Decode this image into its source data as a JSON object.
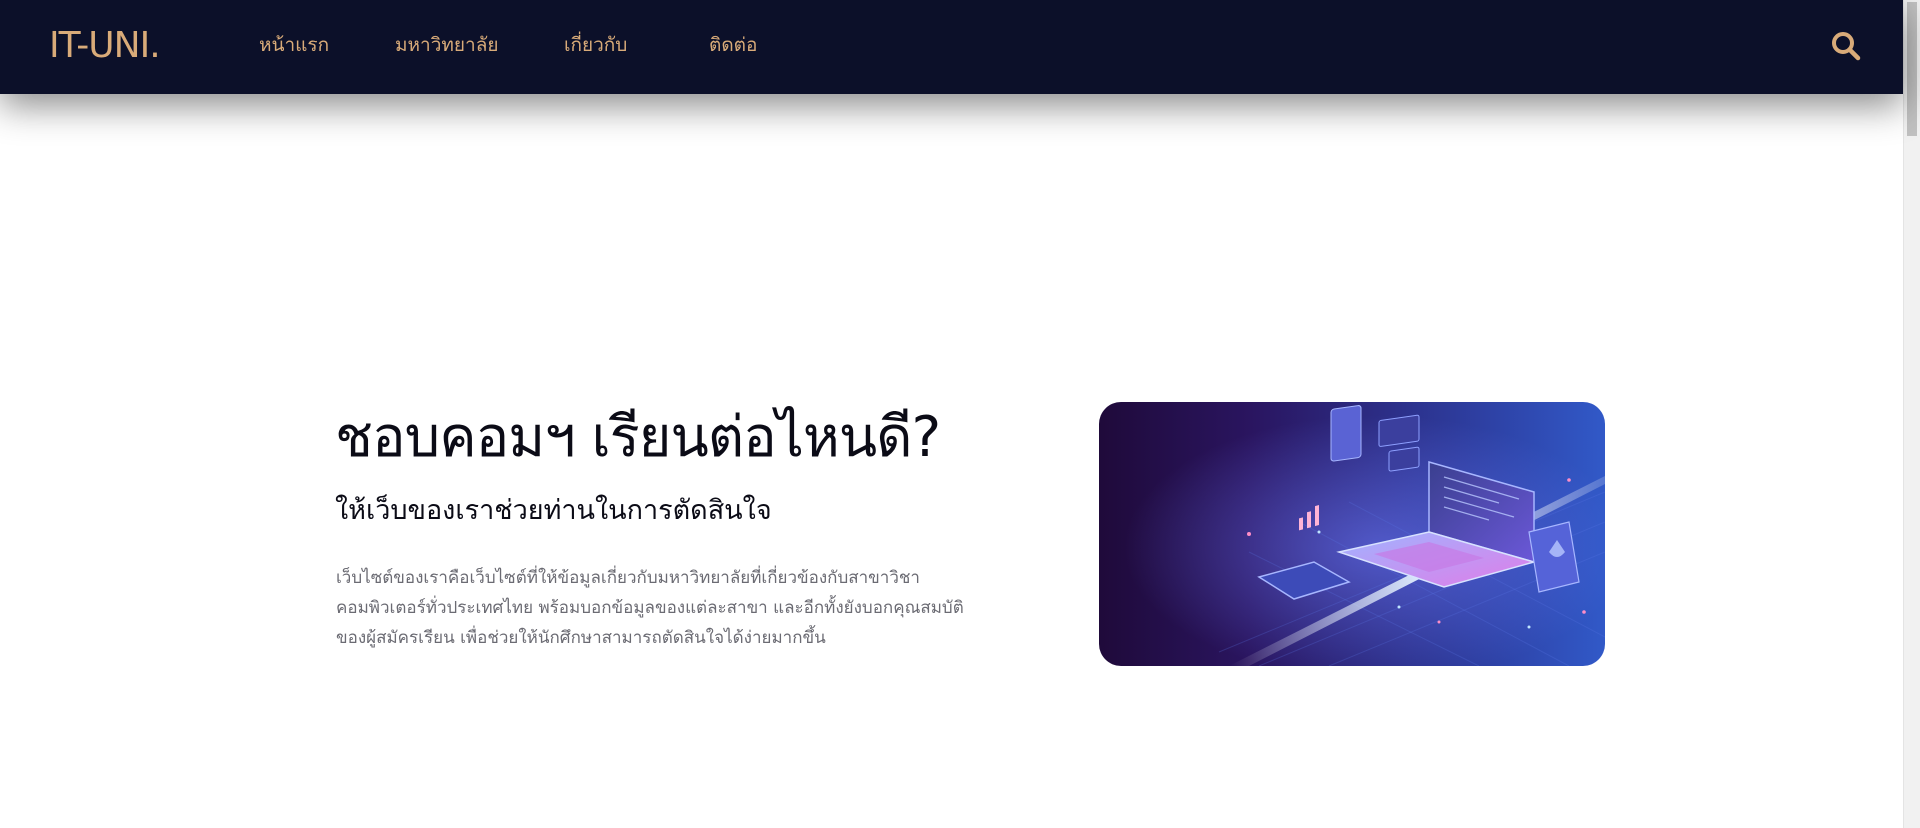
{
  "navbar": {
    "logo": "IT-UNI.",
    "items": [
      {
        "label": "หน้าแรก"
      },
      {
        "label": "มหาวิทยาลัย"
      },
      {
        "label": "เกี่ยวกับ"
      },
      {
        "label": "ติดต่อ"
      }
    ],
    "search_icon": "search-icon"
  },
  "hero": {
    "title": "ชอบคอมฯ เรียนต่อไหนดี?",
    "subtitle": "ให้เว็บของเราช่วยท่านในการตัดสินใจ",
    "description_lines": [
      "เว็บไซต์ของเราคือเว็บไซต์ที่ให้ข้อมูลเกี่ยวกับมหาวิทยาลัยที่เกี่ยวข้องกับสาขาวิชา",
      "คอมพิวเตอร์ทั่วประเทศไทย พร้อมบอกข้อมูลของแต่ละสาขา และอีกทั้งยังบอกคุณสมบัติ",
      "ของผู้สมัครเรียน เพื่อช่วยให้นักศึกษาสามารถตัดสินใจได้ง่ายมากขึ้น"
    ]
  },
  "colors": {
    "navbar_bg": "#0c1029",
    "accent_gold": "#d9ab79",
    "title_text": "#0b0b16",
    "body_text": "#6b6b73"
  }
}
